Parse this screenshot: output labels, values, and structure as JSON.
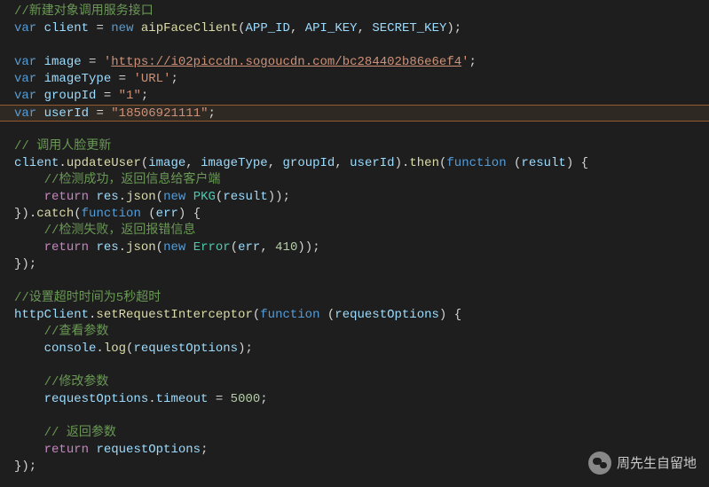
{
  "code": {
    "l1": {
      "comment": "//新建对象调用服务接口"
    },
    "l2": {
      "kw_var": "var",
      "var": "client",
      "op": " = ",
      "kw_new": "new",
      "func": "aipFaceClient",
      "paren_o": "(",
      "arg1": "APP_ID",
      "comma1": ", ",
      "arg2": "API_KEY",
      "comma2": ", ",
      "arg3": "SECRET_KEY",
      "paren_c": ")",
      "semi": ";"
    },
    "l4": {
      "kw_var": "var",
      "var": "image",
      "op": " = ",
      "q1": "'",
      "url": "https://i02piccdn.sogoucdn.com/bc284402b86e6ef4",
      "q2": "'",
      "semi": ";"
    },
    "l5": {
      "kw_var": "var",
      "var": "imageType",
      "op": " = ",
      "str": "'URL'",
      "semi": ";"
    },
    "l6": {
      "kw_var": "var",
      "var": "groupId",
      "op": " = ",
      "str": "\"1\"",
      "semi": ";"
    },
    "l7": {
      "kw_var": "var",
      "var": "userId",
      "op": " = ",
      "str": "\"18506921111\"",
      "semi": ";"
    },
    "l9": {
      "comment": "// 调用人脸更新"
    },
    "l10": {
      "var": "client",
      "dot1": ".",
      "func1": "updateUser",
      "po": "(",
      "a1": "image",
      "c1": ", ",
      "a2": "imageType",
      "c2": ", ",
      "a3": "groupId",
      "c3": ", ",
      "a4": "userId",
      "pc": ")",
      "dot2": ".",
      "func2": "then",
      "po2": "(",
      "kw_fn": "function",
      "sp": " ",
      "po3": "(",
      "param": "result",
      "pc3": ")",
      "brace": " {"
    },
    "l11": {
      "indent": "    ",
      "comment": "//检测成功，返回信息给客户端"
    },
    "l12": {
      "indent": "    ",
      "kw_ret": "return",
      "sp": " ",
      "var": "res",
      "dot": ".",
      "func": "json",
      "po": "(",
      "kw_new": "new",
      "sp2": " ",
      "type": "PKG",
      "po2": "(",
      "arg": "result",
      "pc2": ")",
      "pc": ")",
      "semi": ";"
    },
    "l13": {
      "brace": "})",
      "dot": ".",
      "func": "catch",
      "po": "(",
      "kw_fn": "function",
      "sp": " ",
      "po2": "(",
      "param": "err",
      "pc2": ")",
      "brace2": " {"
    },
    "l14": {
      "indent": "    ",
      "comment": "//检测失败，返回报错信息"
    },
    "l15": {
      "indent": "    ",
      "kw_ret": "return",
      "sp": " ",
      "var": "res",
      "dot": ".",
      "func": "json",
      "po": "(",
      "kw_new": "new",
      "sp2": " ",
      "type": "Error",
      "po2": "(",
      "arg1": "err",
      "comma": ", ",
      "arg2": "410",
      "pc2": ")",
      "pc": ")",
      "semi": ";"
    },
    "l16": {
      "brace": "});"
    },
    "l18": {
      "comment": "//设置超时时间为5秒超时"
    },
    "l19": {
      "var": "httpClient",
      "dot": ".",
      "func": "setRequestInterceptor",
      "po": "(",
      "kw_fn": "function",
      "sp": " ",
      "po2": "(",
      "param": "requestOptions",
      "pc2": ")",
      "brace": " {"
    },
    "l20": {
      "indent": "    ",
      "comment": "//查看参数"
    },
    "l21": {
      "indent": "    ",
      "var": "console",
      "dot": ".",
      "func": "log",
      "po": "(",
      "arg": "requestOptions",
      "pc": ")",
      "semi": ";"
    },
    "l23": {
      "indent": "    ",
      "comment": "//修改参数"
    },
    "l24": {
      "indent": "    ",
      "var": "requestOptions",
      "dot": ".",
      "prop": "timeout",
      "op": " = ",
      "num": "5000",
      "semi": ";"
    },
    "l26": {
      "indent": "    ",
      "comment": "// 返回参数"
    },
    "l27": {
      "indent": "    ",
      "kw_ret": "return",
      "sp": " ",
      "var": "requestOptions",
      "semi": ";"
    },
    "l28": {
      "brace": "});"
    }
  },
  "watermark": {
    "text": "周先生自留地"
  }
}
